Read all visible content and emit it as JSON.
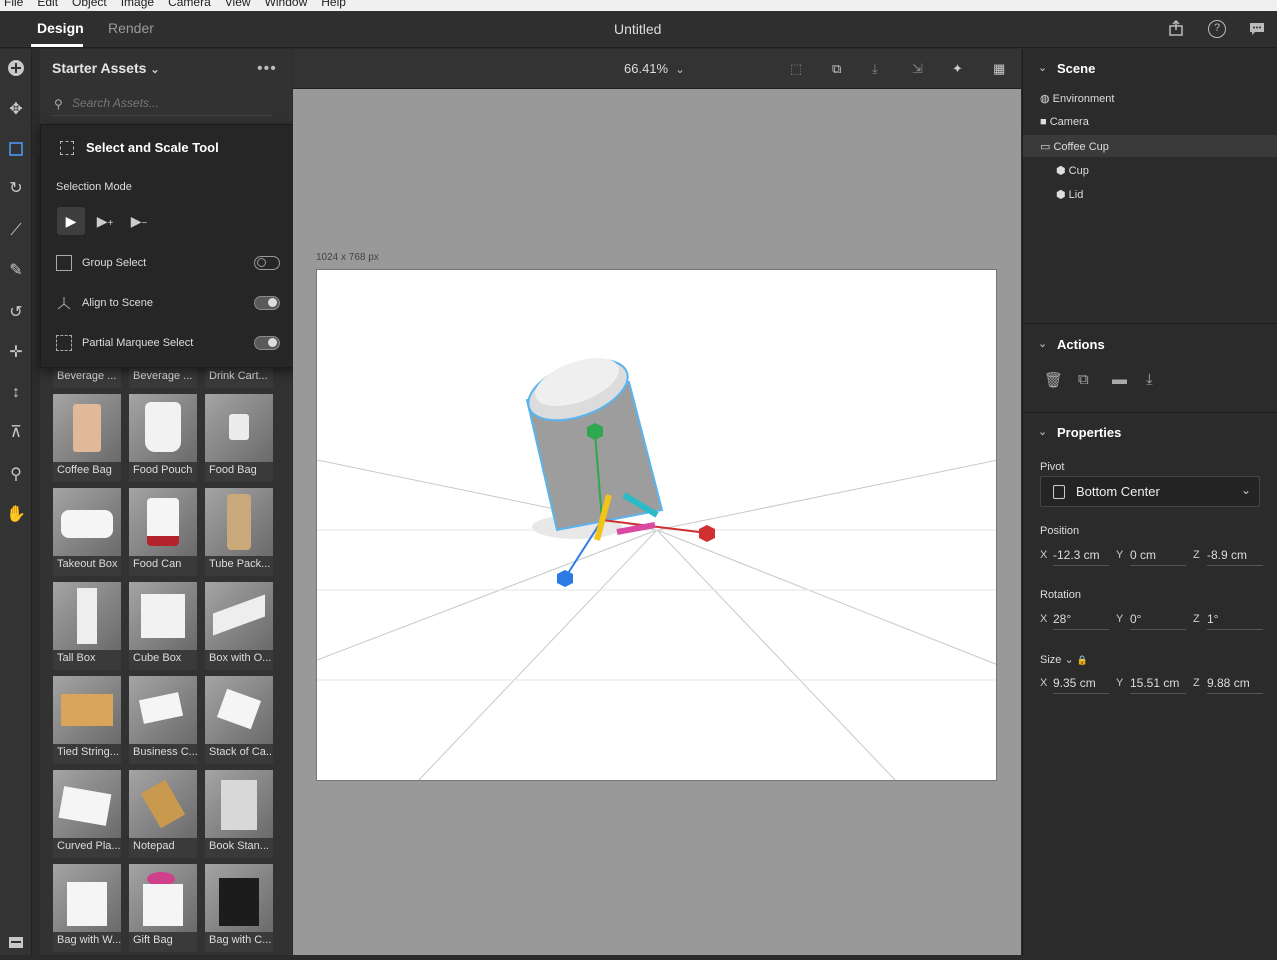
{
  "menu": [
    "File",
    "Edit",
    "Object",
    "Image",
    "Camera",
    "View",
    "Window",
    "Help"
  ],
  "tabs": {
    "design": "Design",
    "render": "Render"
  },
  "document_title": "Untitled",
  "assets": {
    "title": "Starter Assets",
    "search_placeholder": "Search Assets...",
    "items": [
      "Beverage ...",
      "Beverage ...",
      "Drink Cart...",
      "Coffee Bag",
      "Food Pouch",
      "Food Bag",
      "Takeout Box",
      "Food Can",
      "Tube Pack...",
      "Tall Box",
      "Cube Box",
      "Box with O...",
      "Tied String...",
      "Business C...",
      "Stack of Ca...",
      "Curved Pla...",
      "Notepad",
      "Book Stan...",
      "Bag with W...",
      "Gift Bag",
      "Bag with C..."
    ]
  },
  "tool_popup": {
    "title": "Select and Scale Tool",
    "selection_mode": "Selection Mode",
    "options": [
      {
        "label": "Group Select",
        "on": false
      },
      {
        "label": "Align to Scene",
        "on": true
      },
      {
        "label": "Partial Marquee Select",
        "on": true
      }
    ]
  },
  "canvas": {
    "zoom": "66.41%",
    "artboard_size": "1024 x 768 px"
  },
  "scene": {
    "title": "Scene",
    "items": [
      {
        "label": "Environment",
        "icon": "globe-icon"
      },
      {
        "label": "Camera",
        "icon": "camera-icon"
      },
      {
        "label": "Coffee Cup",
        "icon": "folder-icon"
      },
      {
        "label": "Cup",
        "icon": "model-icon"
      },
      {
        "label": "Lid",
        "icon": "model-icon"
      }
    ]
  },
  "actions": {
    "title": "Actions"
  },
  "properties": {
    "title": "Properties",
    "pivot_label": "Pivot",
    "pivot_value": "Bottom Center",
    "position_label": "Position",
    "position": {
      "x": "-12.3 cm",
      "y": "0 cm",
      "z": "-8.9 cm"
    },
    "rotation_label": "Rotation",
    "rotation": {
      "x": "28°",
      "y": "0°",
      "z": "1°"
    },
    "size_label": "Size",
    "size": {
      "x": "9.35 cm",
      "y": "15.51 cm",
      "z": "9.88 cm"
    }
  },
  "axes": {
    "x": "X",
    "y": "Y",
    "z": "Z"
  }
}
